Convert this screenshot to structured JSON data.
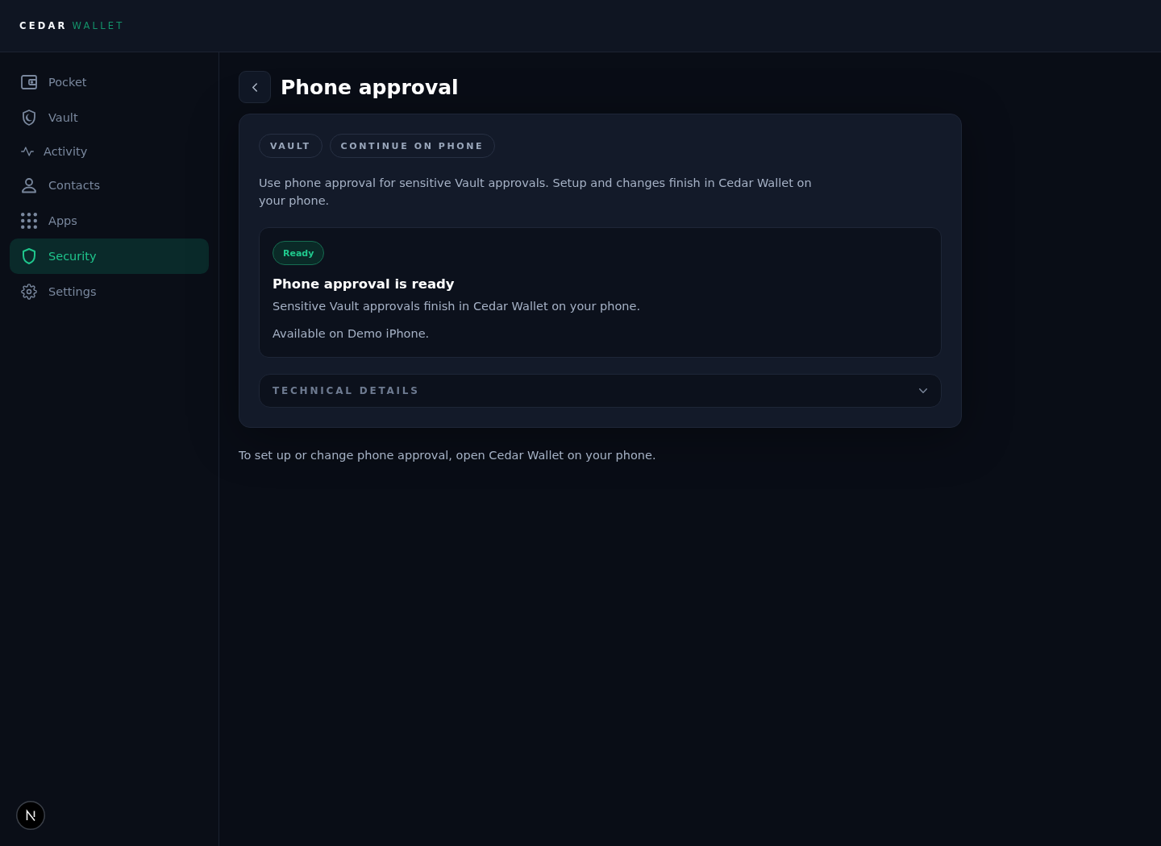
{
  "header": {
    "brand": "CEDAR",
    "brand_suffix": "WALLET"
  },
  "sidebar": {
    "items": [
      {
        "label": "Pocket",
        "selected": false
      },
      {
        "label": "Vault",
        "selected": false
      },
      {
        "label": "Activity",
        "selected": false
      },
      {
        "label": "Contacts",
        "selected": false
      },
      {
        "label": "Apps",
        "selected": false
      },
      {
        "label": "Security",
        "selected": true
      },
      {
        "label": "Settings",
        "selected": false
      }
    ]
  },
  "page": {
    "title": "Phone approval"
  },
  "card": {
    "tags": [
      "VAULT",
      "CONTINUE ON PHONE"
    ],
    "description": "Use phone approval for sensitive Vault approvals. Setup and changes finish in Cedar Wallet on your phone.",
    "status": {
      "badge": "Ready",
      "title": "Phone approval is ready",
      "lines": [
        "Sensitive Vault approvals finish in Cedar Wallet on your phone.",
        "Available on Demo iPhone."
      ]
    },
    "technical_details": {
      "label": "TECHNICAL DETAILS",
      "expanded": false
    }
  },
  "footer_note": "To set up or change phone approval, open Cedar Wallet on your phone."
}
